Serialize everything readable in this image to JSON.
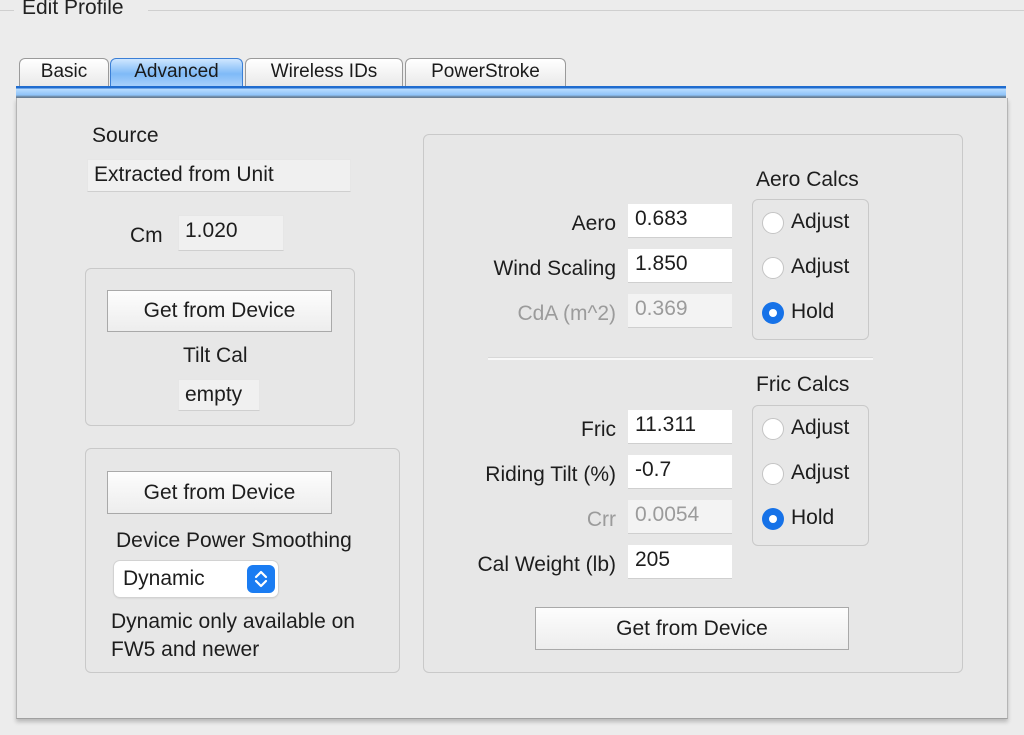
{
  "group": {
    "title": "Edit Profile"
  },
  "tabs": [
    {
      "label": "Basic",
      "active": false
    },
    {
      "label": "Advanced",
      "active": true
    },
    {
      "label": "Wireless IDs",
      "active": false
    },
    {
      "label": "PowerStroke",
      "active": false
    }
  ],
  "left": {
    "source_label": "Source",
    "source_value": "Extracted from Unit",
    "cm_label": "Cm",
    "cm_value": "1.020",
    "tilt_box": {
      "button": "Get from Device",
      "label": "Tilt Cal",
      "value": "empty"
    },
    "smoothing_box": {
      "button": "Get from Device",
      "label": "Device Power Smoothing",
      "select_value": "Dynamic",
      "note_line1": "Dynamic only available on",
      "note_line2": "FW5 and newer"
    }
  },
  "right": {
    "aero_calcs": {
      "title": "Aero Calcs",
      "rows": [
        {
          "label": "Aero",
          "value": "0.683",
          "enabled": true,
          "radio": "Adjust",
          "selected": false
        },
        {
          "label": "Wind Scaling",
          "value": "1.850",
          "enabled": true,
          "radio": "Adjust",
          "selected": false
        },
        {
          "label": "CdA (m^2)",
          "value": "0.369",
          "enabled": false,
          "radio": "Hold",
          "selected": true
        }
      ]
    },
    "fric_calcs": {
      "title": "Fric Calcs",
      "rows": [
        {
          "label": "Fric",
          "value": "11.311",
          "enabled": true,
          "radio": "Adjust",
          "selected": false
        },
        {
          "label": "Riding Tilt (%)",
          "value": "-0.7",
          "enabled": true,
          "radio": "Adjust",
          "selected": false
        },
        {
          "label": "Crr",
          "value": "0.0054",
          "enabled": false,
          "radio": "Hold",
          "selected": true
        }
      ]
    },
    "cal_weight": {
      "label": "Cal Weight (lb)",
      "value": "205"
    },
    "button": "Get from Device"
  },
  "colors": {
    "accent": "#1672e8",
    "tab_active": "#7fbaf7"
  }
}
